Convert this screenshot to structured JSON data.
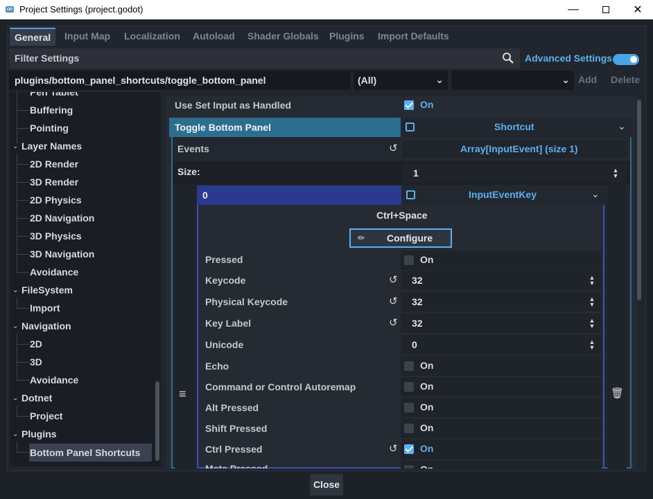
{
  "window": {
    "title": "Project Settings (project.godot)",
    "minimize_icon": "minimize-icon",
    "maximize_icon": "maximize-icon",
    "close_icon": "close-icon"
  },
  "tabs": [
    {
      "label": "General",
      "active": true
    },
    {
      "label": "Input Map"
    },
    {
      "label": "Localization"
    },
    {
      "label": "Autoload"
    },
    {
      "label": "Shader Globals"
    },
    {
      "label": "Plugins"
    },
    {
      "label": "Import Defaults"
    }
  ],
  "filter": {
    "placeholder": "Filter Settings",
    "icon": "search-icon",
    "advanced_label": "Advanced Settings",
    "advanced_on": true
  },
  "path_bar": {
    "value": "plugins/bottom_panel_shortcuts/toggle_bottom_panel",
    "type_filter": "(All)",
    "type_value": "",
    "add_label": "Add",
    "delete_label": "Delete"
  },
  "tree": {
    "items": [
      {
        "label": "Pen Tablet"
      },
      {
        "label": "Buffering"
      },
      {
        "label": "Pointing"
      },
      {
        "label": "Layer Names"
      },
      {
        "label": "2D Render"
      },
      {
        "label": "3D Render"
      },
      {
        "label": "2D Physics"
      },
      {
        "label": "2D Navigation"
      },
      {
        "label": "3D Physics"
      },
      {
        "label": "3D Navigation"
      },
      {
        "label": "Avoidance"
      },
      {
        "label": "FileSystem"
      },
      {
        "label": "Import"
      },
      {
        "label": "Navigation"
      },
      {
        "label": "2D"
      },
      {
        "label": "3D"
      },
      {
        "label": "Avoidance"
      },
      {
        "label": "Dotnet"
      },
      {
        "label": "Project"
      },
      {
        "label": "Plugins"
      },
      {
        "label": "Bottom Panel Shortcuts"
      }
    ]
  },
  "inspector": {
    "use_set_input": {
      "label": "Use Set Input as Handled",
      "value": "On",
      "checked": true
    },
    "toggle": {
      "label": "Toggle Bottom Panel",
      "type": "Shortcut"
    },
    "events": {
      "label": "Events",
      "value": "Array[InputEvent] (size 1)"
    },
    "size": {
      "label": "Size:",
      "value": "1"
    },
    "element": {
      "index": "0",
      "type": "InputEventKey",
      "shortcut_text": "Ctrl+Space",
      "configure_label": "Configure"
    },
    "props": [
      {
        "label": "Pressed",
        "kind": "check",
        "value": "On",
        "checked": false
      },
      {
        "label": "Keycode",
        "kind": "num",
        "value": "32",
        "revert": true
      },
      {
        "label": "Physical Keycode",
        "kind": "num",
        "value": "32",
        "revert": true
      },
      {
        "label": "Key Label",
        "kind": "num",
        "value": "32",
        "revert": true
      },
      {
        "label": "Unicode",
        "kind": "num",
        "value": "0"
      },
      {
        "label": "Echo",
        "kind": "check",
        "value": "On",
        "checked": false
      },
      {
        "label": "Command or Control Autoremap",
        "kind": "check",
        "value": "On",
        "checked": false
      },
      {
        "label": "Alt Pressed",
        "kind": "check",
        "value": "On",
        "checked": false
      },
      {
        "label": "Shift Pressed",
        "kind": "check",
        "value": "On",
        "checked": false
      },
      {
        "label": "Ctrl Pressed",
        "kind": "check",
        "value": "On",
        "checked": true,
        "revert": true
      },
      {
        "label": "Meta Pressed",
        "kind": "check",
        "value": "On",
        "checked": false
      }
    ]
  },
  "footer": {
    "close_label": "Close"
  },
  "colors": {
    "accent": "#57a0d8",
    "toggle_header": "#2d6e8e",
    "element_header": "#2a3a8e",
    "element_border": "#3b4fb8"
  }
}
